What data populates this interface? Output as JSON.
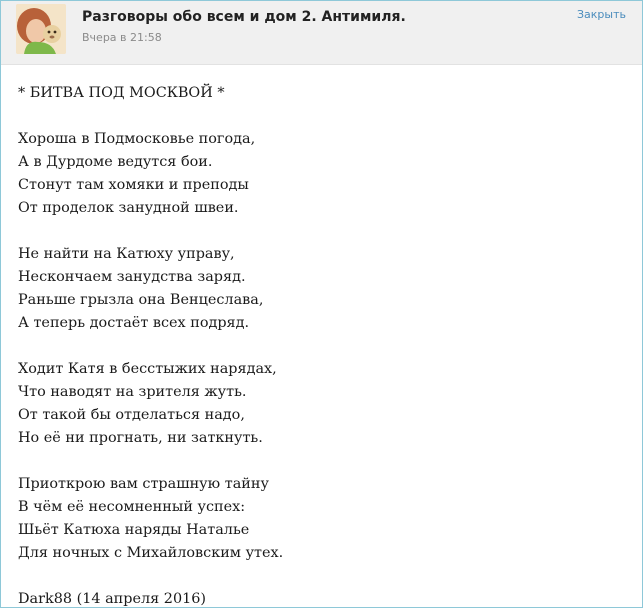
{
  "header": {
    "title": "Разговоры обо всем и дом 2. Антимиля.",
    "time": "Вчера в 21:58",
    "close_label": "Закрыть"
  },
  "post": {
    "heading": "* БИТВА ПОД МОСКВОЙ *",
    "stanzas": [
      [
        "Хороша в Подмосковье погода,",
        "А в Дурдоме ведутся бои.",
        "Стонут там хомяки и преподы",
        "От проделок занудной швеи."
      ],
      [
        "Не найти на Катюху управу,",
        "Нескончаем занудства заряд.",
        "Раньше грызла она Венцеслава,",
        "А теперь достаёт всех подряд."
      ],
      [
        "Ходит Катя в бесстыжих нарядах,",
        "Что наводят на зрителя жуть.",
        "От такой бы отделаться надо,",
        "Но её ни прогнать, ни заткнуть."
      ],
      [
        "Приоткрою вам страшную тайну",
        "В чём её несомненный успех:",
        "Шьёт Катюха наряды Наталье",
        "Для ночных с Михайловским утех."
      ]
    ],
    "signature": "Dark88 (14 апреля 2016)"
  },
  "colors": {
    "border": "#8ec8d8",
    "header_bg": "#f0f0f0",
    "link": "#4a8cbc"
  }
}
